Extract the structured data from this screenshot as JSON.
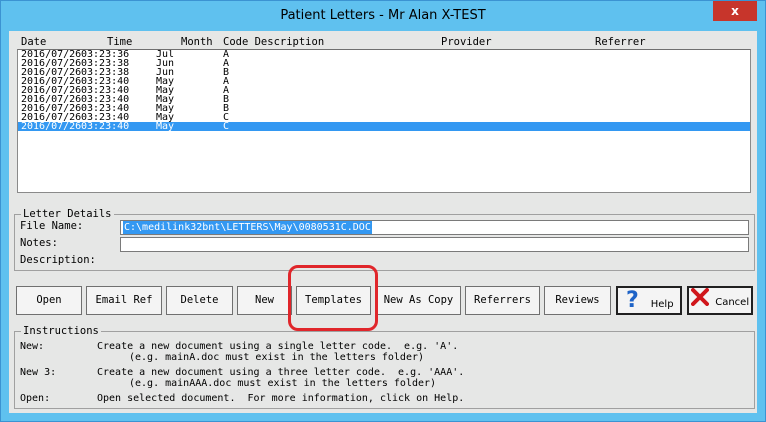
{
  "window": {
    "title": "Patient Letters - Mr Alan X-TEST",
    "close_label": "x"
  },
  "list": {
    "headers": {
      "date": "Date",
      "time": "Time",
      "month": "Month",
      "code_description": "Code Description",
      "provider": "Provider",
      "referrer": "Referrer"
    },
    "rows": [
      {
        "date": "2016/07/26",
        "time": "03:23:36",
        "month": "Jul",
        "code": "A"
      },
      {
        "date": "2016/07/26",
        "time": "03:23:38",
        "month": "Jun",
        "code": "A"
      },
      {
        "date": "2016/07/26",
        "time": "03:23:38",
        "month": "Jun",
        "code": "B"
      },
      {
        "date": "2016/07/26",
        "time": "03:23:40",
        "month": "May",
        "code": "A"
      },
      {
        "date": "2016/07/26",
        "time": "03:23:40",
        "month": "May",
        "code": "A"
      },
      {
        "date": "2016/07/26",
        "time": "03:23:40",
        "month": "May",
        "code": "B"
      },
      {
        "date": "2016/07/26",
        "time": "03:23:40",
        "month": "May",
        "code": "B"
      },
      {
        "date": "2016/07/26",
        "time": "03:23:40",
        "month": "May",
        "code": "C"
      },
      {
        "date": "2016/07/26",
        "time": "03:23:40",
        "month": "May",
        "code": "C"
      }
    ]
  },
  "details": {
    "group_label": "Letter Details",
    "file_name_label": "File Name:",
    "file_name_value": "C:\\medilink32bnt\\LETTERS\\May\\0080531C.DOC",
    "notes_label": "Notes:",
    "notes_value": "",
    "description_label": "Description:"
  },
  "buttons": {
    "open": "Open",
    "email_ref": "Email Ref",
    "delete": "Delete",
    "new": "New",
    "templates": "Templates",
    "new_as_copy": "New As Copy",
    "referrers": "Referrers",
    "reviews": "Reviews",
    "help": "Help",
    "cancel": "Cancel"
  },
  "instructions": {
    "group_label": "Instructions",
    "items": [
      {
        "label": "New:",
        "line1": "Create a new document using a single letter code.  e.g. 'A'.",
        "line2": "(e.g. mainA.doc must exist in the letters folder)"
      },
      {
        "label": "New 3:",
        "line1": "Create a new document using a three letter code.  e.g. 'AAA'.",
        "line2": "(e.g. mainAAA.doc must exist in the letters folder)"
      },
      {
        "label": "Open:",
        "line1": "Open selected document.  For more information, click on Help.",
        "line2": ""
      }
    ]
  },
  "colors": {
    "titlebar": "#5fc1ef",
    "selection": "#3398f2",
    "close": "#c7352b",
    "annotation": "#e0262b"
  }
}
